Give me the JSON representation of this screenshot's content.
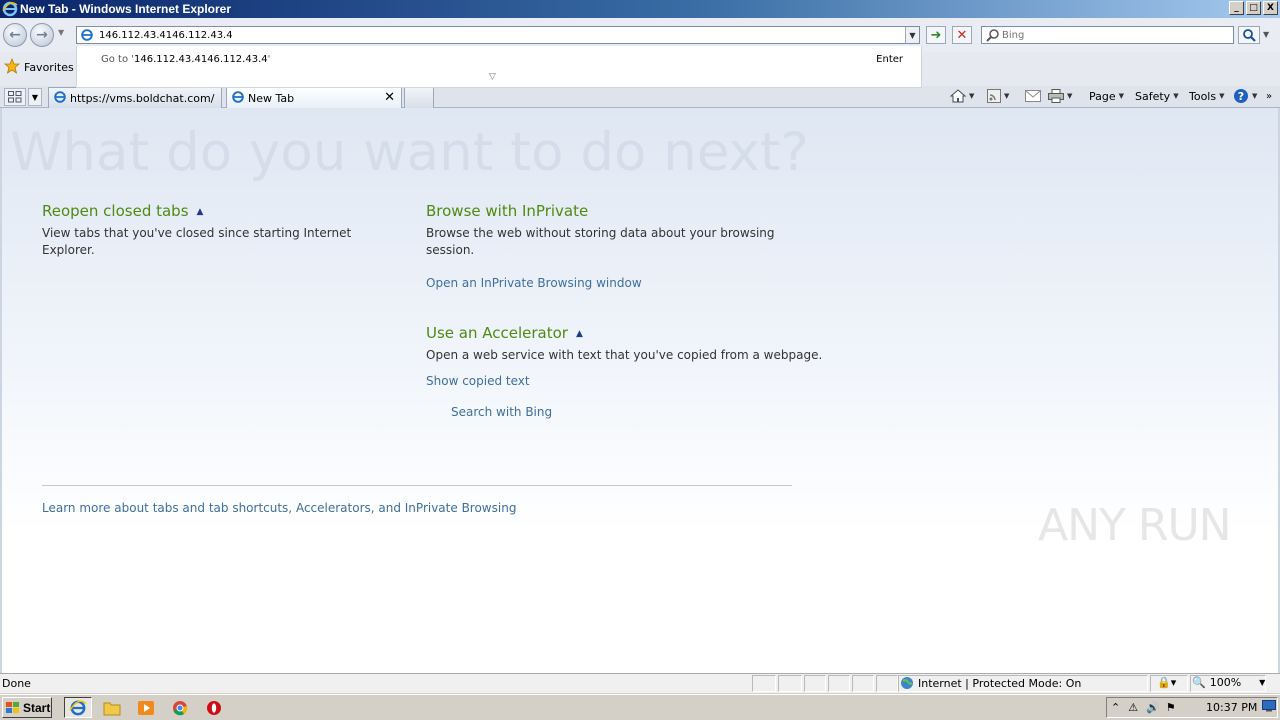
{
  "window": {
    "title": "New Tab - Windows Internet Explorer",
    "controls": [
      "_",
      "□",
      "X"
    ]
  },
  "nav": {
    "address_value": "146.112.43.4146.112.43.4",
    "search_placeholder": "Bing"
  },
  "address_dropdown": {
    "goto_prefix": "Go to '",
    "goto_url": "146.112.43.4146.112.43.4",
    "goto_suffix": "'",
    "enter_label": "Enter"
  },
  "favorites": {
    "label": "Favorites"
  },
  "tabs": [
    {
      "label": "https://vms.boldchat.com/",
      "active": false
    },
    {
      "label": "New Tab",
      "active": true
    }
  ],
  "command_bar": {
    "page_label": "Page",
    "safety_label": "Safety",
    "tools_label": "Tools"
  },
  "content": {
    "headline": "What do you want to do next?",
    "reopen": {
      "title": "Reopen closed tabs",
      "desc": "View tabs that you've closed since starting Internet Explorer."
    },
    "inprivate": {
      "title": "Browse with InPrivate",
      "desc": "Browse the web without storing data about your browsing session.",
      "link": "Open an InPrivate Browsing window"
    },
    "accelerator": {
      "title": "Use an Accelerator",
      "desc": "Open a web service with text that you've copied from a webpage.",
      "show_link": "Show copied text",
      "search_link": "Search with Bing"
    },
    "learn_more": "Learn more about tabs and tab shortcuts, Accelerators, and InPrivate Browsing"
  },
  "watermark": "ANY RUN",
  "status": {
    "text": "Done",
    "zone": "Internet | Protected Mode: On",
    "zoom": "100%"
  },
  "taskbar": {
    "start_label": "Start",
    "clock": "10:37 PM"
  },
  "colors": {
    "title_accent": "#4f8a10",
    "link": "#3f6f9c",
    "titlebar": "#0a246a"
  }
}
